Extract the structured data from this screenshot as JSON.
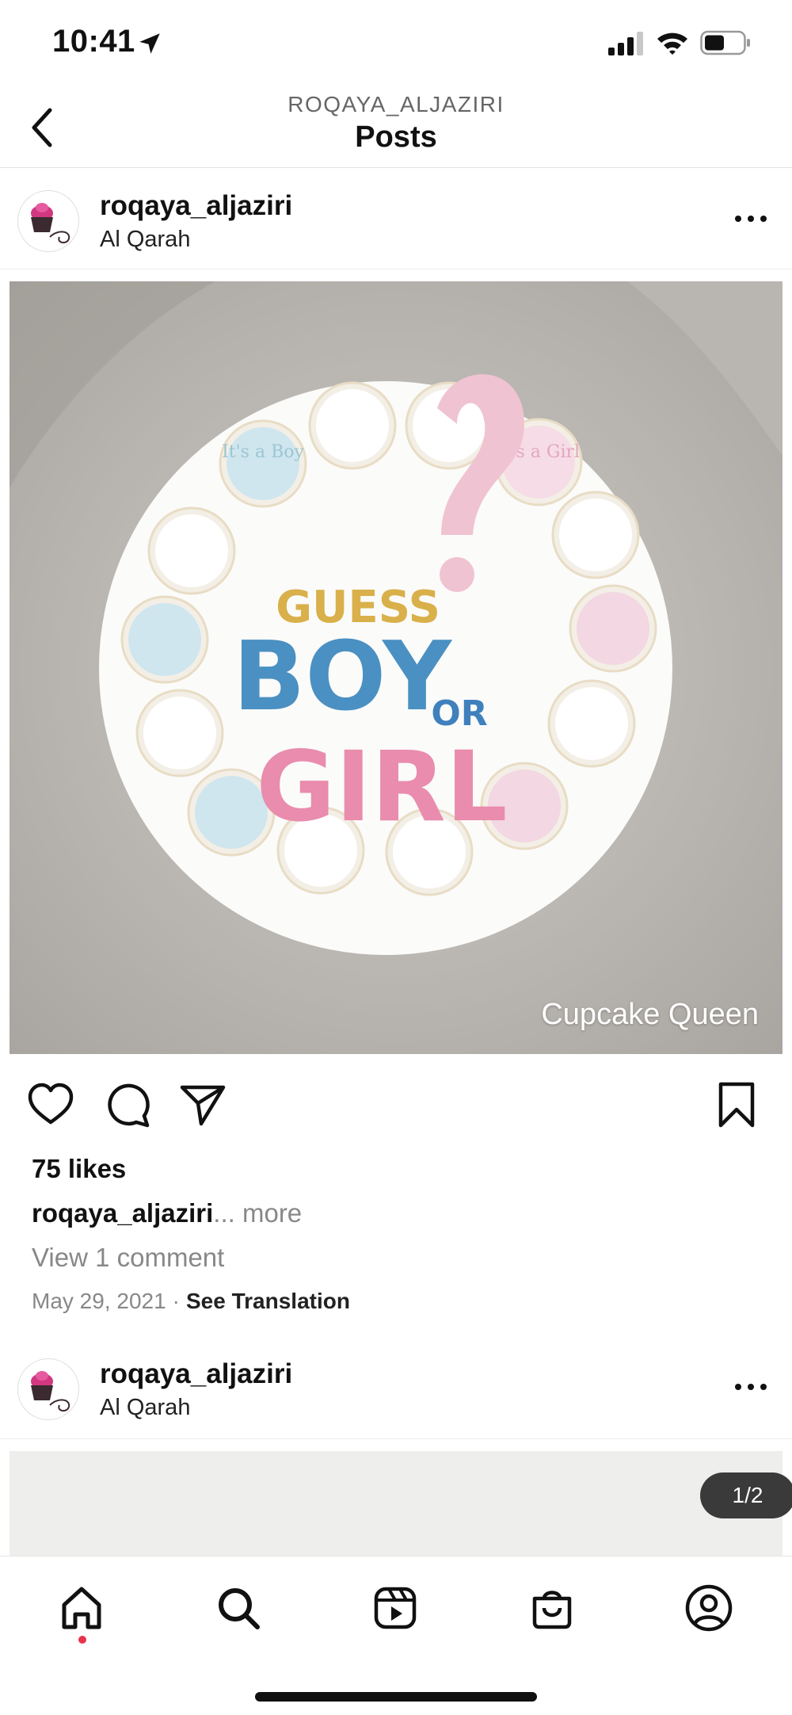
{
  "status_bar": {
    "time": "10:41"
  },
  "header": {
    "subtitle": "ROQAYA_ALJAZIRI",
    "title": "Posts"
  },
  "post": {
    "username": "roqaya_aljaziri",
    "location": "Al Qarah",
    "image_watermark": "Cupcake Queen",
    "image_cake_text": {
      "line1": "GUESS",
      "line2": "BOY",
      "line3": "OR",
      "line4": "GIRL"
    },
    "cupcake_texts": {
      "boy": "It's a Boy",
      "girl": "It's a Girl"
    },
    "likes": "75 likes",
    "caption_user": "roqaya_aljaziri",
    "caption_more": "... more",
    "view_comments": "View 1 comment",
    "date": "May 29, 2021",
    "date_separator": "·",
    "see_translation": "See Translation"
  },
  "next_post": {
    "username": "roqaya_aljaziri",
    "location": "Al Qarah",
    "image_counter": "1/2"
  },
  "colors": {
    "accent_dot": "#e8344e",
    "text": "#111111",
    "muted": "#888888"
  },
  "icons": {
    "status": [
      "location-arrow-icon",
      "signal-icon",
      "wifi-icon",
      "battery-icon"
    ],
    "actions": [
      "heart-icon",
      "comment-icon",
      "share-icon",
      "bookmark-icon"
    ],
    "tabs": [
      "home-icon",
      "search-icon",
      "reels-icon",
      "shop-icon",
      "profile-icon"
    ]
  }
}
